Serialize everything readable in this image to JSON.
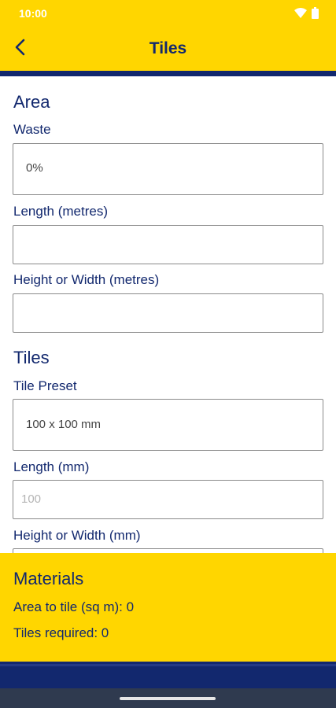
{
  "status_bar": {
    "time": "10:00"
  },
  "app_bar": {
    "title": "Tiles",
    "back_icon": "chevron-left-icon"
  },
  "area_section": {
    "title": "Area",
    "waste": {
      "label": "Waste",
      "value": "0%"
    },
    "length": {
      "label": "Length (metres)",
      "value": ""
    },
    "height_width": {
      "label": "Height or Width (metres)",
      "value": ""
    }
  },
  "tiles_section": {
    "title": "Tiles",
    "preset": {
      "label": "Tile Preset",
      "value": "100 x 100 mm"
    },
    "length": {
      "label": "Length (mm)",
      "placeholder": "100"
    },
    "height_width": {
      "label": "Height or Width (mm)"
    }
  },
  "materials": {
    "title": "Materials",
    "area_to_tile": "Area to tile (sq m): 0",
    "tiles_required": "Tiles required: 0"
  },
  "colors": {
    "accent": "#ffd600",
    "brand_navy": "#12286e"
  }
}
